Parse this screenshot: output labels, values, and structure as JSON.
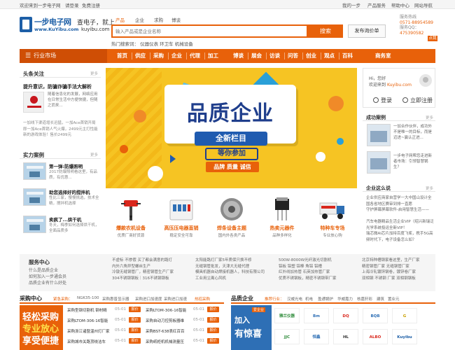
{
  "topbar": {
    "welcome": "欢迎来到一步电子网",
    "login": "请登录",
    "register": "免费注册",
    "right": [
      "我的一步",
      "产品服务",
      "帮助中心",
      "网站导航"
    ]
  },
  "logo": {
    "name_cn": "一步电子网",
    "domain_en": "www.KuYibu.com",
    "slogan": "查电子，就上",
    "slogan_domain": "kuyibu.com"
  },
  "search": {
    "tabs": [
      "产品",
      "企业",
      "求购",
      "博谈"
    ],
    "active_tab": "产品",
    "placeholder": "输入产品或是企业名称",
    "button": "搜索",
    "publish": "发布询价单",
    "hot_label": "热门搜索词：",
    "hot_terms": [
      "仪器仪表",
      "环卫车",
      "机械设备"
    ]
  },
  "service": {
    "phone_label": "服务热线",
    "phone": "0571-88954589",
    "qq_label": "服务QQ：",
    "qq": "475390582",
    "qq_badge": "点我"
  },
  "nav": {
    "category": "行业市场",
    "items": [
      "首页",
      "供应",
      "采购",
      "企业",
      "代理",
      "加工",
      "博谈",
      "展会",
      "访谈",
      "问答",
      "创业",
      "观点",
      "百科",
      "商务室"
    ]
  },
  "headlines": {
    "title": "头条关注",
    "more": "更多",
    "top_title": "提升意识，防骗诈骗手法大解析",
    "top_desc": "随着信息化的发展，网络应用在日常生活中方便快捷，但随之而来...",
    "lines": [
      "一加线下渠道增长迅猛，一加Ace首销开局即一加Ace首销人气火爆，2499元主打性能新的游戏体验！售价2499元"
    ]
  },
  "cases": {
    "title": "实力案例",
    "more": "更多",
    "items": [
      {
        "title": "第一弹:防爆照明",
        "desc": "2017防爆照明看这里，有品质，有优惠..."
      },
      {
        "title": "助您选择好的搅拌机",
        "desc": "性比三家，慢慢挑选，技术全精，搅拌机选择"
      },
      {
        "title": "卖疯了...烘干机",
        "desc": "冬天，梅季如何选择烘干机，全面品质多"
      }
    ]
  },
  "banner": {
    "title": "品质企业",
    "sub1": "全新栏目",
    "sub2": "等你参加",
    "sub3": "品牌 质量 诚信"
  },
  "products": [
    {
      "name": "爆款农机设备",
      "desc": "优质厂商好货源"
    },
    {
      "name": "高压压电器直销",
      "desc": "稳定安全可靠"
    },
    {
      "name": "焊条设备主题",
      "desc": "国内外各类产品"
    },
    {
      "name": "热卖元器件",
      "desc": "品种多样化"
    },
    {
      "name": "特种车专场",
      "desc": "专业放心购"
    }
  ],
  "user": {
    "hi": "Hi，您好",
    "welcome": "欢迎来到",
    "site": "Kuyibu.com",
    "login": "登录",
    "register": "立即注册"
  },
  "success": {
    "title": "成功案例",
    "more": "更多",
    "items": [
      {
        "text": "一加合作伙伴，成功外不是唯一的目标，而是迈进~赢认正进..."
      },
      {
        "text": "一步电子网帮您走进新者市场：引领智慧锅生？"
      }
    ]
  },
  "industry": {
    "title": "企业这么说",
    "more": "更多",
    "lines": [
      "企业供应商家自营学一大中国山设计全国各省地区赛审到排一直愿",
      "守护屏幕屏幕软件-启用智慧生活——",
      "汽车电器精品生活企业VIP（绍兴新瑞泛光学系统投运全新VIP！",
      "瑞芯微AI芯片加持百度飞桨，携手5G高频时代下，电子设备怎么如？"
    ]
  },
  "service_center": {
    "title": "服务中心",
    "links": [
      "什么是品质企业",
      "如何加入一步通会员",
      "品质企业有什么好处"
    ],
    "col1": [
      "不虚标 不掺假 买了都会满意的路灯",
      "内外六角异型螺丝生产",
      "冷镦无缝钢管厂，精密钢管生产厂家",
      "304不锈钢钢板｜316不锈钢钢板"
    ],
    "col2": [
      "太阳能路灯厂家5年质保只换不修",
      "无缝钢管批发，天津大无缝代理",
      "模具机器自动焊接机器人，科技有限公司",
      "工业用尘离心风机"
    ],
    "col3": [
      "500W-8000W光纤激光切割机",
      "铝板 铝塑 铝棒 角铝 铝槽",
      "红外线加热管 石英加热管厂家",
      "优质不锈钢板，精密不锈钢带厂家"
    ],
    "col4": [
      "北京特种槽钢家看这里，生产厂家",
      "精密钢管厂家 无缝钢管厂家",
      "上海冷轧镀锌钢卷，镀锌卷厂家",
      "双相钢 不锈钢 厂家 双相钢钢板"
    ]
  },
  "purchase": {
    "title": "采购中心",
    "tags_label": "紧急采购：",
    "tags": [
      "NGK35-100",
      "采购惠普显示器",
      "采购进口加速度",
      "采购显示器厂",
      "采购进口加速",
      "热招采购"
    ],
    "ad": [
      "轻松采购",
      "专业放心",
      "享受便捷"
    ],
    "action": "报价",
    "rows": [
      [
        {
          "t": "采购型钢切割机 钢材精",
          "d": "05-01"
        },
        {
          "t": "采购LTOM-306-16智能",
          "d": "05-01"
        }
      ],
      [
        {
          "t": "采购LTOM-306-16智能",
          "d": "05-01"
        },
        {
          "t": "采购自动刀控剪板器维",
          "d": "05-01"
        }
      ],
      [
        {
          "t": "采购浙江诸暨温州灯厂家",
          "d": "05-01"
        },
        {
          "t": "采购BST-638表红百百",
          "d": "05-01"
        }
      ],
      [
        {
          "t": "采购城市关路顶绕洁车",
          "d": "05-01"
        },
        {
          "t": "采购纸柜机机械测量压",
          "d": "05-01"
        }
      ]
    ]
  },
  "brands": {
    "title": "品质企业",
    "tags_label": "推荐行业：",
    "tags": [
      "汉威光电",
      "机电",
      "盈通锅炉",
      "华威嘉力",
      "核嘉轩彩",
      "建筑",
      "置业元"
    ],
    "ad": {
      "tag": "爱企业",
      "l1": "加入",
      "l2": "有惊喜"
    },
    "logos": [
      "雅兰仪器",
      "Bm",
      "DQ",
      "BQB",
      "G",
      "JJC",
      "恒鑫",
      "HL",
      "ALBO",
      "Kuyibu"
    ]
  }
}
